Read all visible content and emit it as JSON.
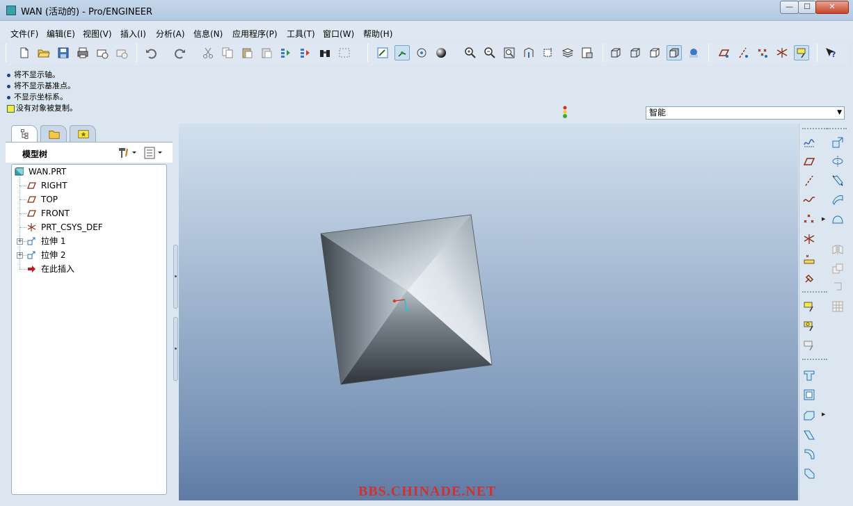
{
  "window": {
    "title": "WAN (活动的) - Pro/ENGINEER",
    "minimize_icon": "minimize-icon",
    "maximize_icon": "maximize-icon",
    "close_icon": "close-icon",
    "min_glyph": "—",
    "max_glyph": "☐",
    "close_glyph": "✕"
  },
  "menu": {
    "items": [
      "文件(F)",
      "编辑(E)",
      "视图(V)",
      "插入(I)",
      "分析(A)",
      "信息(N)",
      "应用程序(P)",
      "工具(T)",
      "窗口(W)",
      "帮助(H)"
    ]
  },
  "messages": {
    "lines": [
      "将不显示轴。",
      "将不显示基准点。",
      "不显示坐标系。",
      "没有对象被复制。"
    ]
  },
  "filter": {
    "selected": "智能",
    "arrow": "▼"
  },
  "navigator": {
    "header_label": "模型树"
  },
  "tree": {
    "root": "WAN.PRT",
    "items": [
      "RIGHT",
      "TOP",
      "FRONT",
      "PRT_CSYS_DEF",
      "拉伸 1",
      "拉伸 2",
      "在此插入"
    ],
    "expand_glyph": "+"
  },
  "viewport": {
    "watermark": "BBS.CHINADE.NET"
  },
  "colors": {
    "titlebar": "#b9cde4",
    "panel": "#dce6f0",
    "datum_plane": "#8a2d10",
    "insert_arrow": "#c8141c",
    "watermark": "#d0322f"
  }
}
